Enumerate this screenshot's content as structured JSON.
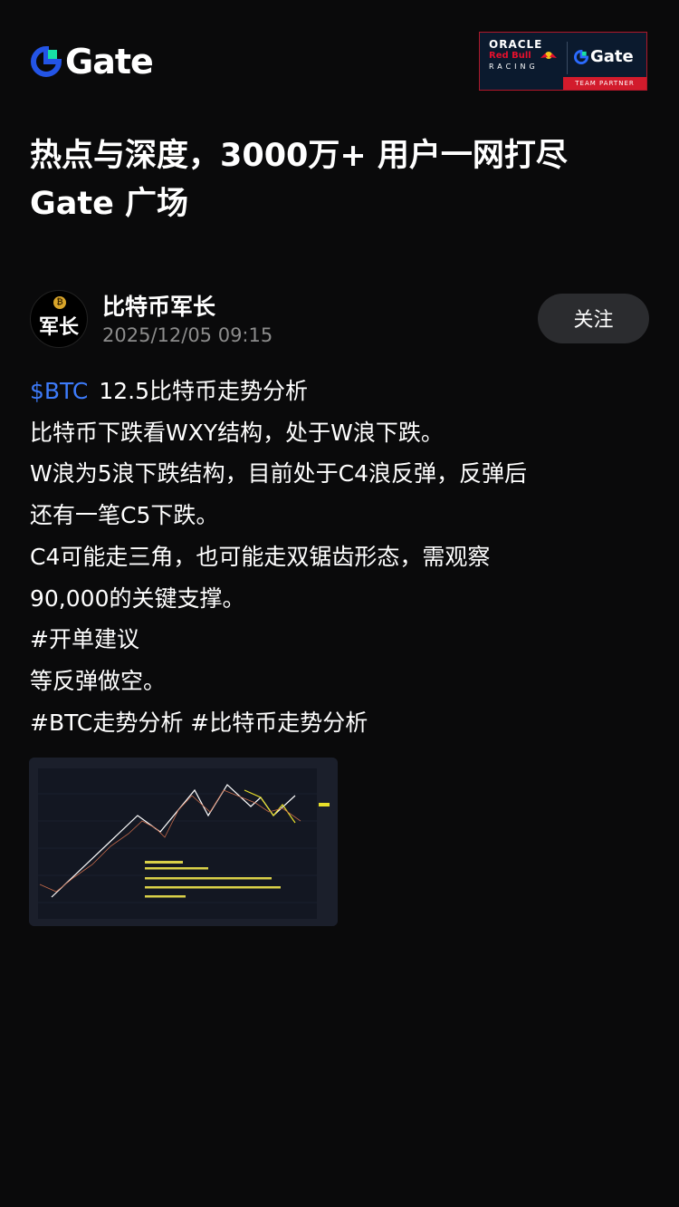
{
  "brand": {
    "name": "Gate",
    "accent": "#2354e6",
    "highlight": "#17e0a6"
  },
  "partner": {
    "oracle": "ORACLE",
    "redbull": "Red Bull",
    "racing": "RACING",
    "gate": "Gate",
    "tagline": "TEAM PARTNER"
  },
  "headline": {
    "line1": "热点与深度，3000万+ 用户一网打尽",
    "line2": "Gate 广场"
  },
  "post": {
    "author": {
      "name": "比特币军长",
      "avatar_text": "军长"
    },
    "time": "2025/12/05 09:15",
    "follow_label": "关注",
    "ticker": "$BTC",
    "lines": {
      "l1": "12.5比特币走势分析",
      "l2": "比特币下跌看WXY结构，处于W浪下跌。",
      "l3": "W浪为5浪下跌结构，目前处于C4浪反弹，反弹后",
      "l4": "还有一笔C5下跌。",
      "l5": "C4可能走三角，也可能走双锯齿形态，需观察",
      "l6": "90,000的关键支撑。",
      "l7": "#开单建议",
      "l8": "等反弹做空。",
      "l9": "#BTC走势分析  #比特币走势分析"
    },
    "ticker_color": "#3d7bfa"
  },
  "colors": {
    "background": "#0a0a0b",
    "muted": "#8c8c8c",
    "button_bg": "#2b2c2f"
  }
}
